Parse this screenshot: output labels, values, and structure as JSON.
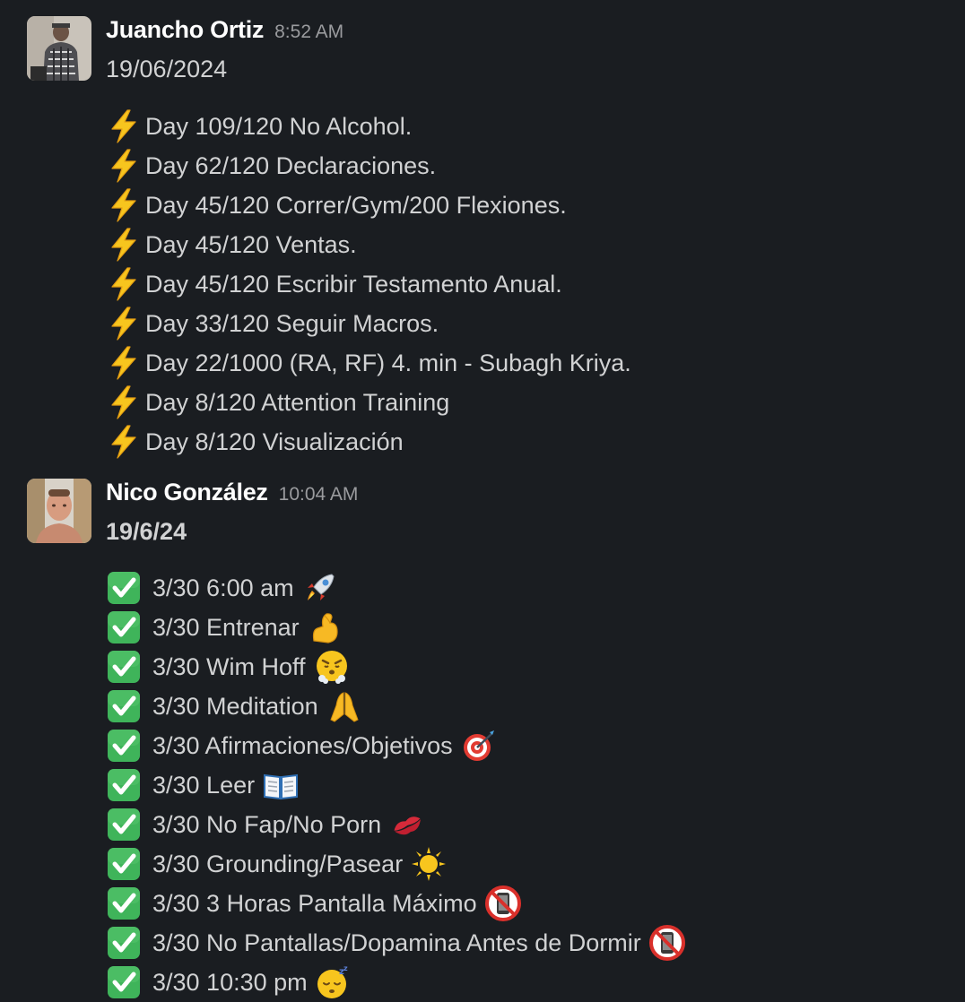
{
  "messages": [
    {
      "author": "Juancho Ortiz",
      "time": "8:52 AM",
      "date": "19/06/2024",
      "lines": [
        "Day 109/120 No Alcohol.",
        "Day 62/120 Declaraciones.",
        "Day 45/120 Correr/Gym/200 Flexiones.",
        "Day 45/120 Ventas.",
        "Day 45/120 Escribir Testamento Anual.",
        "Day 33/120 Seguir Macros.",
        "Day 22/1000 (RA, RF) 4. min - Subagh Kriya.",
        "Day 8/120 Attention Training",
        "Day 8/120 Visualización"
      ],
      "line_icon": "high-voltage-icon"
    },
    {
      "author": "Nico González",
      "time": "10:04 AM",
      "date": "19/6/24",
      "line_icon": "check-mark-button-icon",
      "items": [
        {
          "text": "3/30 6:00 am",
          "emoji": "rocket-icon"
        },
        {
          "text": "3/30 Entrenar",
          "emoji": "flexed-biceps-icon"
        },
        {
          "text": "3/30 Wim Hoff",
          "emoji": "face-with-steam-icon"
        },
        {
          "text": "3/30 Meditation",
          "emoji": "folded-hands-icon"
        },
        {
          "text": "3/30 Afirmaciones/Objetivos",
          "emoji": "direct-hit-icon"
        },
        {
          "text": "3/30 Leer",
          "emoji": "open-book-icon"
        },
        {
          "text": "3/30 No Fap/No Porn",
          "emoji": "kiss-mark-icon"
        },
        {
          "text": "3/30 Grounding/Pasear",
          "emoji": "sun-icon"
        },
        {
          "text": "3/30 3 Horas Pantalla Máximo",
          "emoji": "no-mobile-phones-icon"
        },
        {
          "text": "3/30 No Pantallas/Dopamina Antes de Dormir",
          "emoji": "no-mobile-phones-icon"
        },
        {
          "text": "3/30 10:30 pm",
          "emoji": "sleeping-face-icon"
        }
      ]
    }
  ],
  "colors": {
    "background": "#1a1d21",
    "author": "#ffffff",
    "timestamp": "#9a9b9e",
    "text": "#d1d2d3",
    "check_green": "#3fb45a",
    "bolt_yellow": "#f7c51e"
  }
}
